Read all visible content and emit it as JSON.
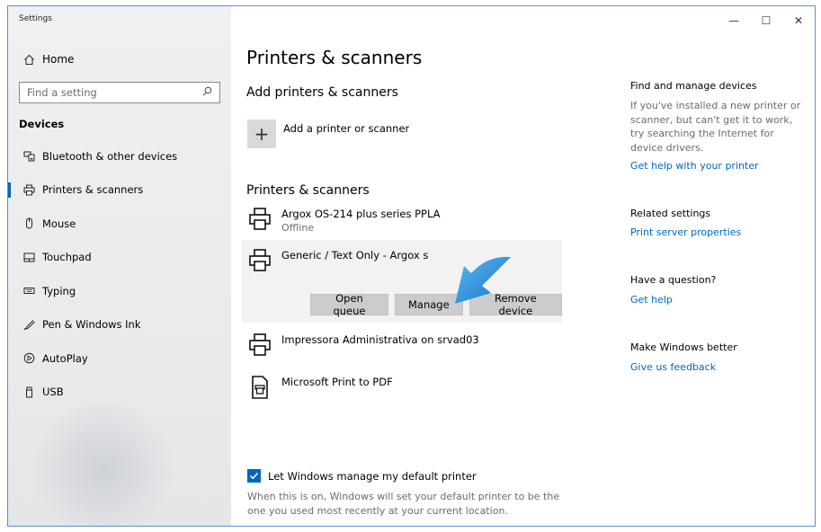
{
  "window": {
    "title": "Settings",
    "controls": [
      "—",
      "☐",
      "✕"
    ]
  },
  "sidebar": {
    "home_label": "Home",
    "search_placeholder": "Find a setting",
    "section_label": "Devices",
    "items": [
      {
        "label": "Bluetooth & other devices",
        "icon": "bluetooth-devices-icon"
      },
      {
        "label": "Printers & scanners",
        "icon": "printer-icon",
        "active": true
      },
      {
        "label": "Mouse",
        "icon": "mouse-icon"
      },
      {
        "label": "Touchpad",
        "icon": "touchpad-icon"
      },
      {
        "label": "Typing",
        "icon": "keyboard-icon"
      },
      {
        "label": "Pen & Windows Ink",
        "icon": "pen-icon"
      },
      {
        "label": "AutoPlay",
        "icon": "autoplay-icon"
      },
      {
        "label": "USB",
        "icon": "usb-icon"
      }
    ]
  },
  "main": {
    "page_title": "Printers & scanners",
    "add_heading": "Add printers & scanners",
    "add_label": "Add a printer or scanner",
    "list_heading": "Printers & scanners",
    "printers": [
      {
        "name": "Argox OS-214 plus series PPLA",
        "status": "Offline"
      },
      {
        "name": "Generic / Text Only - Argox s",
        "status": ""
      },
      {
        "name": "Impressora Administrativa on srvad03",
        "status": ""
      },
      {
        "name": "Microsoft Print to PDF",
        "status": ""
      }
    ],
    "buttons": {
      "open_queue": "Open queue",
      "manage": "Manage",
      "remove_device": "Remove device"
    },
    "default_printer_label": "Let Windows manage my default printer",
    "default_printer_checked": true,
    "default_printer_desc": "When this is on, Windows will set your default printer to be the one you used most recently at your current location."
  },
  "right": {
    "find_title": "Find and manage devices",
    "find_text": "If you've installed a new printer or scanner, but can't get it to work, try searching the Internet for device drivers.",
    "find_link": "Get help with your printer",
    "related_title": "Related settings",
    "related_link": "Print server properties",
    "question_title": "Have a question?",
    "question_link": "Get help",
    "better_title": "Make Windows better",
    "better_link": "Give us feedback"
  },
  "colors": {
    "accent": "#0067c0",
    "window_border": "#5a8fd6",
    "arrow": "#2a8fd8"
  }
}
